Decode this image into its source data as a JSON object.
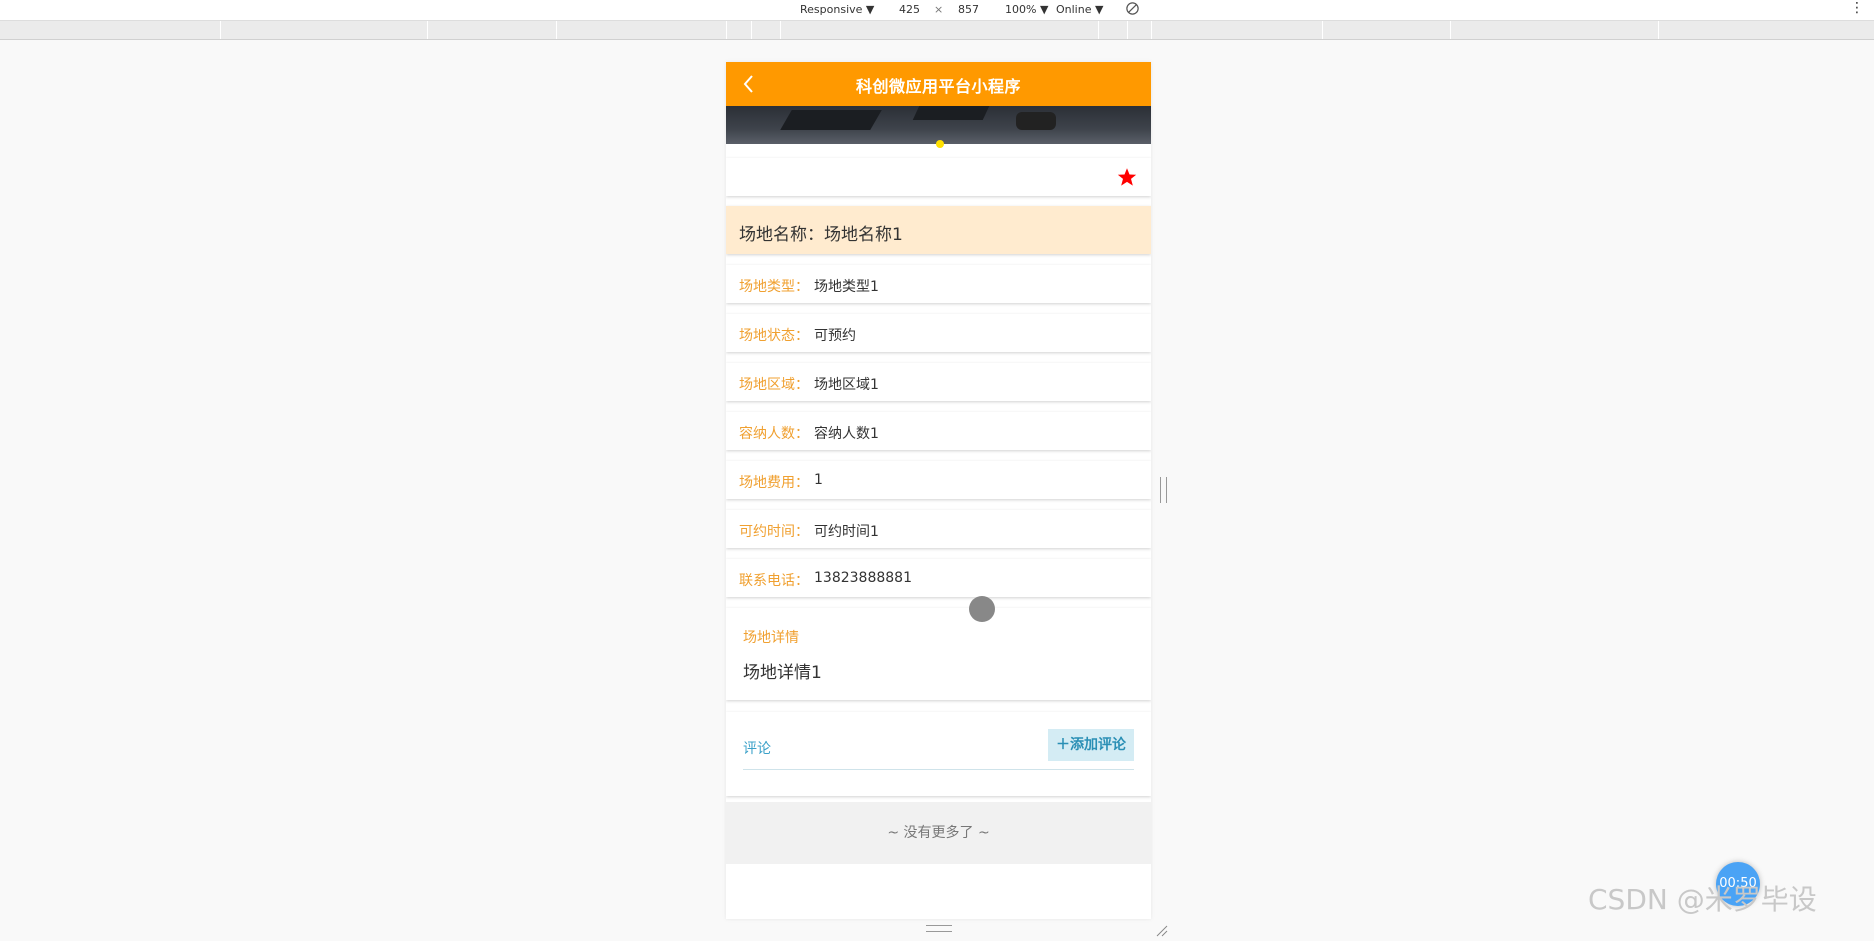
{
  "devtools": {
    "mode": "Responsive",
    "width": "425",
    "times": "×",
    "height": "857",
    "zoom": "100%",
    "network": "Online",
    "dropdown_arrow": "▼",
    "more": "⋮"
  },
  "app": {
    "title": "科创微应用平台小程序",
    "name_label": "场地名称：",
    "name_value": "场地名称1",
    "fields": [
      {
        "label": "场地类型：",
        "value": "场地类型1"
      },
      {
        "label": "场地状态：",
        "value": "可预约"
      },
      {
        "label": "场地区域：",
        "value": "场地区域1"
      },
      {
        "label": "容纳人数：",
        "value": "容纳人数1"
      },
      {
        "label": "场地费用：",
        "value": "1"
      },
      {
        "label": "可约时间：",
        "value": "可约时间1"
      },
      {
        "label": "联系电话：",
        "value": "13823888881"
      }
    ],
    "detail_label": "场地详情",
    "detail_value": "场地详情1",
    "comment_label": "评论",
    "add_comment_label": "＋添加评论",
    "no_more": "~ 没有更多了 ~",
    "colors": {
      "header": "#ff9900",
      "label": "#f0a030",
      "accent": "#3aa0c8",
      "star": "#ff0000"
    }
  },
  "overlay": {
    "timer": "00:50",
    "watermark": "CSDN @米罗毕设"
  }
}
